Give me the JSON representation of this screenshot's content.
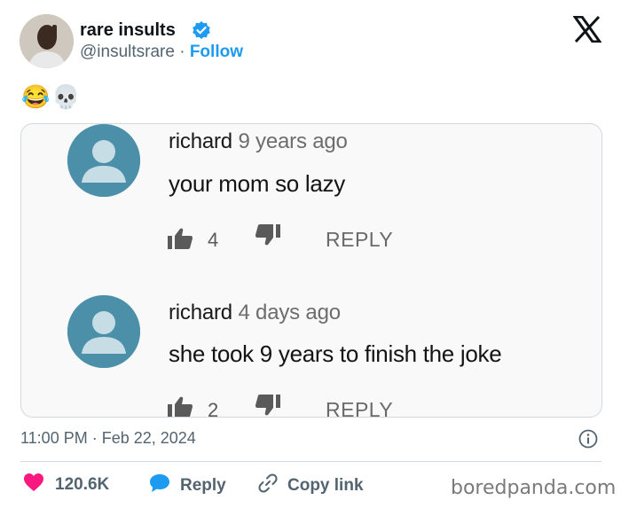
{
  "tweet": {
    "author_name": "rare insults",
    "handle": "@insultsrare",
    "separator": "·",
    "follow_label": "Follow",
    "body_emojis": "😂💀",
    "timestamp": "11:00 PM · Feb 22, 2024"
  },
  "image": {
    "comments": [
      {
        "user": "richard",
        "time": "9 years ago",
        "text": "your mom so lazy",
        "likes": "4",
        "reply_label": "REPLY"
      },
      {
        "user": "richard",
        "time": "4 days ago",
        "text": "she took 9 years to finish the joke",
        "likes": "2",
        "reply_label": "REPLY"
      }
    ]
  },
  "actions": {
    "like_count": "120.6K",
    "reply_label": "Reply",
    "copy_link_label": "Copy link"
  },
  "watermark": "boredpanda.com",
  "colors": {
    "accent": "#1d9bf0",
    "like": "#f91880",
    "secondary_text": "#536471",
    "comment_avatar": "#4b90a8"
  },
  "icons": [
    "verified-badge-icon",
    "x-logo-icon",
    "thumbs-up-icon",
    "thumbs-down-icon",
    "info-icon",
    "heart-icon",
    "reply-bubble-icon",
    "link-icon"
  ]
}
